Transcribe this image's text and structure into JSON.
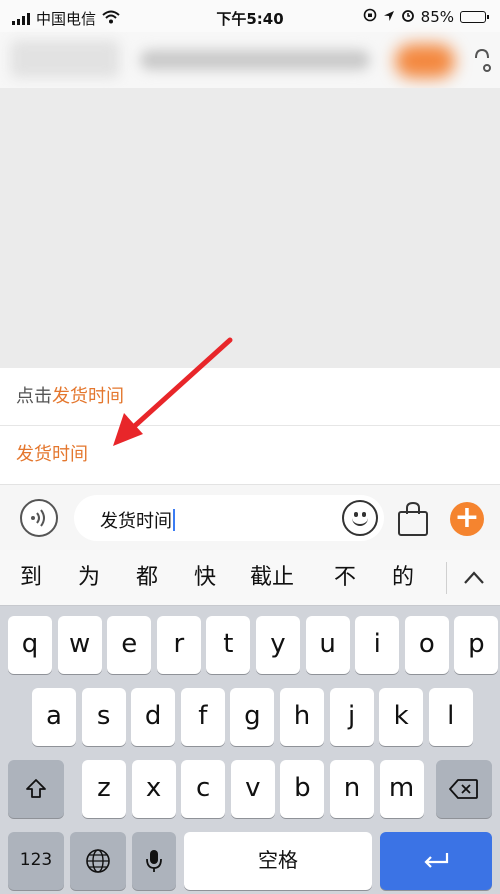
{
  "status_bar": {
    "carrier": "中国电信",
    "time": "下午5:40",
    "battery": "85%",
    "battery_level": 0.85
  },
  "suggestions": [
    {
      "prefix": "点击",
      "highlight": "发货时间"
    },
    {
      "prefix": "",
      "highlight": "发货时间"
    }
  ],
  "input": {
    "value": "发货时间"
  },
  "candidates": [
    "到",
    "为",
    "都",
    "快",
    "截止",
    "不",
    "的"
  ],
  "keyboard": {
    "row1": [
      "q",
      "w",
      "e",
      "r",
      "t",
      "y",
      "u",
      "i",
      "o",
      "p"
    ],
    "row2": [
      "a",
      "s",
      "d",
      "f",
      "g",
      "h",
      "j",
      "k",
      "l"
    ],
    "row3": [
      "z",
      "x",
      "c",
      "v",
      "b",
      "n",
      "m"
    ],
    "numbers_label": "123",
    "space_label": "空格"
  },
  "colors": {
    "accent": "#e4772e",
    "plus_button": "#f5842f",
    "arrow": "#e8262a"
  }
}
